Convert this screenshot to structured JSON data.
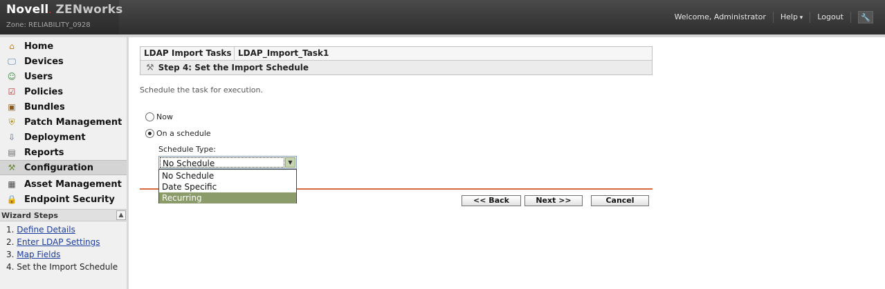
{
  "header": {
    "brand_novell": "Novell",
    "brand_dot": ".",
    "brand_product": "ZENworks",
    "zone": "Zone: RELIABILITY_0928",
    "welcome": "Welcome, Administrator",
    "help": "Help",
    "logout": "Logout"
  },
  "sidebar": {
    "items": [
      {
        "label": "Home",
        "icon": "home-icon"
      },
      {
        "label": "Devices",
        "icon": "devices-icon"
      },
      {
        "label": "Users",
        "icon": "users-icon"
      },
      {
        "label": "Policies",
        "icon": "policies-icon"
      },
      {
        "label": "Bundles",
        "icon": "bundles-icon"
      },
      {
        "label": "Patch Management",
        "icon": "shield-icon"
      },
      {
        "label": "Deployment",
        "icon": "deployment-icon"
      },
      {
        "label": "Reports",
        "icon": "reports-icon"
      },
      {
        "label": "Configuration",
        "icon": "wrench-icon"
      },
      {
        "label": "Asset Management",
        "icon": "asset-icon"
      },
      {
        "label": "Endpoint Security",
        "icon": "lock-icon"
      }
    ],
    "active_item": "Configuration",
    "wizard": {
      "title": "Wizard Steps",
      "steps": [
        {
          "num": "1.",
          "label": "Define Details"
        },
        {
          "num": "2.",
          "label": "Enter LDAP Settings"
        },
        {
          "num": "3.",
          "label": "Map Fields"
        },
        {
          "num": "4.",
          "label": "Set the Import Schedule"
        }
      ]
    }
  },
  "main": {
    "breadcrumb": {
      "section": "LDAP Import Tasks",
      "task": "LDAP_Import_Task1"
    },
    "step_title": "Step 4: Set the Import Schedule",
    "description": "Schedule the task for execution.",
    "options": {
      "now": "Now",
      "on_schedule": "On a schedule",
      "selected": "On a schedule"
    },
    "schedule_type": {
      "label": "Schedule Type:",
      "value": "No Schedule",
      "options": [
        "No Schedule",
        "Date Specific",
        "Recurring"
      ],
      "highlighted": "Recurring"
    },
    "buttons": {
      "back": "<< Back",
      "next": "Next >>",
      "cancel": "Cancel"
    }
  },
  "colors": {
    "header_bg": "#333333",
    "divider": "#d66a3c",
    "dropdown_highlight": "#8b9b6a",
    "link": "#1a3c9c"
  }
}
